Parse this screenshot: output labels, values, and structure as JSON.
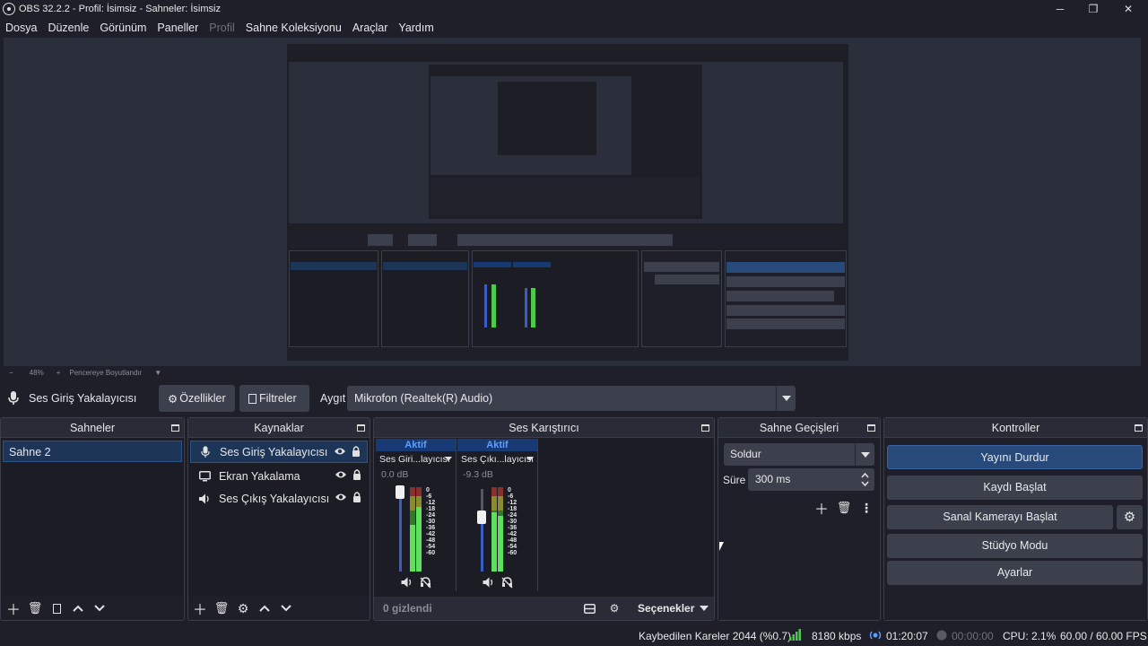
{
  "window": {
    "title": "OBS 32.2.2 - Profil: İsimsiz - Sahneler: İsimsiz",
    "minimize": "─",
    "maximize": "❐",
    "close": "✕"
  },
  "menu": [
    {
      "label": "Dosya",
      "disabled": false
    },
    {
      "label": "Düzenle",
      "disabled": false
    },
    {
      "label": "Görünüm",
      "disabled": false
    },
    {
      "label": "Paneller",
      "disabled": false
    },
    {
      "label": "Profil",
      "disabled": true
    },
    {
      "label": "Sahne Koleksiyonu",
      "disabled": false
    },
    {
      "label": "Araçlar",
      "disabled": false
    },
    {
      "label": "Yardım",
      "disabled": false
    }
  ],
  "zoombar": {
    "minus": "−",
    "zoom": "48%",
    "plus": "+",
    "fit": "Pencereye Boyutlandır"
  },
  "context": {
    "source_name": "Ses Giriş Yakalayıcısı",
    "properties_label": "Özellikler",
    "filters_label": "Filtreler",
    "device_label": "Aygıt",
    "device_value": "Mikrofon (Realtek(R) Audio)"
  },
  "docks": {
    "scenes": {
      "title": "Sahneler",
      "items": [
        "Sahne 2"
      ]
    },
    "sources": {
      "title": "Kaynaklar",
      "items": [
        {
          "label": "Ses Giriş Yakalayıcısı",
          "icon": "microphone-icon"
        },
        {
          "label": "Ekran Yakalama",
          "icon": "monitor-icon"
        },
        {
          "label": "Ses Çıkış Yakalayıcısı",
          "icon": "speaker-icon"
        }
      ]
    },
    "mixer": {
      "title": "Ses Karıştırıcı",
      "channels": [
        {
          "status": "Aktif",
          "name": "Ses Giri...layıcısı",
          "db": "0.0 dB",
          "volume": 1.0
        },
        {
          "status": "Aktif",
          "name": "Ses Çıkı...layıcısı",
          "db": "-9.3 dB",
          "volume": 0.65
        }
      ],
      "scale": [
        "0",
        "-6",
        "-12",
        "-18",
        "-24",
        "-30",
        "-36",
        "-42",
        "-48",
        "-54",
        "-60"
      ],
      "hidden_label": "0 gizlendi",
      "options_label": "Seçenekler"
    },
    "transitions": {
      "title": "Sahne Geçişleri",
      "transition": "Soldur",
      "duration_label": "Süre",
      "duration_value": "300 ms"
    },
    "controls": {
      "title": "Kontroller",
      "stop_stream": "Yayını Durdur",
      "start_record": "Kaydı Başlat",
      "start_virtualcam": "Sanal Kamerayı Başlat",
      "studio_mode": "Stüdyo Modu",
      "settings": "Ayarlar"
    }
  },
  "status": {
    "dropped_frames": "Kaybedilen Kareler 2044 (%0.7)",
    "bitrate": "8180 kbps",
    "stream_time": "01:20:07",
    "record_time": "00:00:00",
    "cpu": "CPU: 2.1%",
    "fps": "60.00 / 60.00 FPS"
  },
  "colors": {
    "accent": "#284a7a",
    "selection": "#1d3556",
    "active_text": "#5d9fff",
    "meter_green": "#4ec94e",
    "meter_yellow": "#c9c94e",
    "meter_red": "#c94e4e"
  }
}
